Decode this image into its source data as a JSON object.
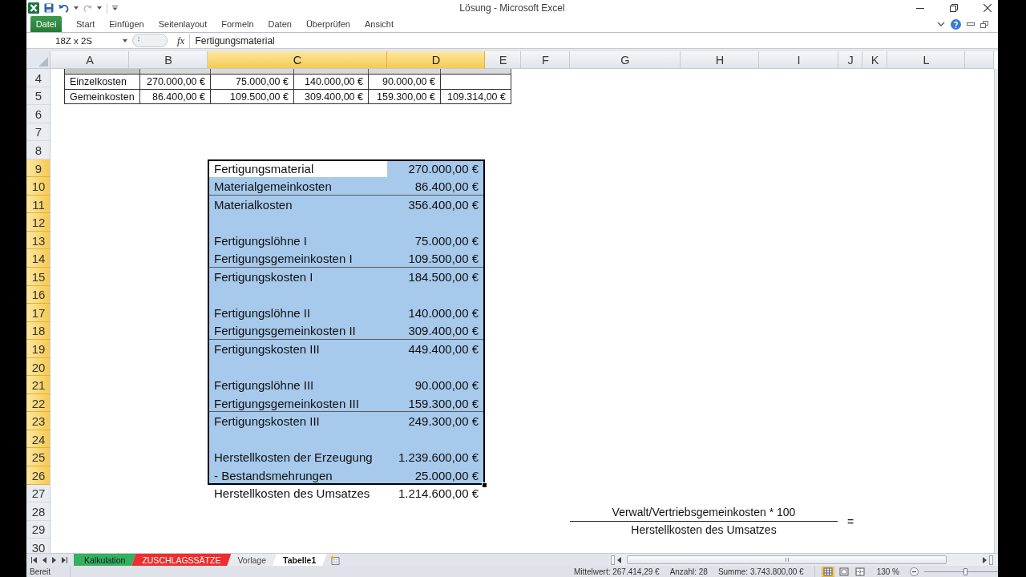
{
  "window": {
    "title": "Lösung - Microsoft Excel"
  },
  "ribbon_tabs": [
    {
      "label": "Datei",
      "kind": "file"
    },
    {
      "label": "Start",
      "kind": "tab"
    },
    {
      "label": "Einfügen",
      "kind": "tab"
    },
    {
      "label": "Seitenlayout",
      "kind": "tab"
    },
    {
      "label": "Formeln",
      "kind": "tab"
    },
    {
      "label": "Daten",
      "kind": "tab"
    },
    {
      "label": "Überprüfen",
      "kind": "tab"
    },
    {
      "label": "Ansicht",
      "kind": "tab"
    }
  ],
  "formula_bar": {
    "name_box": "18Z x 2S",
    "function_label": "fx",
    "content": "Fertigungsmaterial"
  },
  "columns": [
    {
      "label": "A",
      "selected": false
    },
    {
      "label": "B",
      "selected": false
    },
    {
      "label": "C",
      "selected": true
    },
    {
      "label": "D",
      "selected": true
    },
    {
      "label": "E",
      "selected": false
    },
    {
      "label": "F",
      "selected": false
    },
    {
      "label": "G",
      "selected": false
    },
    {
      "label": "H",
      "selected": false
    },
    {
      "label": "I",
      "selected": false
    },
    {
      "label": "J",
      "selected": false
    },
    {
      "label": "K",
      "selected": false
    },
    {
      "label": "L",
      "selected": false
    }
  ],
  "row_headers": [
    {
      "number": "4",
      "selected": false
    },
    {
      "number": "5",
      "selected": false
    },
    {
      "number": "6",
      "selected": false
    },
    {
      "number": "7",
      "selected": false
    },
    {
      "number": "8",
      "selected": false
    },
    {
      "number": "9",
      "selected": true
    },
    {
      "number": "10",
      "selected": true
    },
    {
      "number": "11",
      "selected": true
    },
    {
      "number": "12",
      "selected": true
    },
    {
      "number": "13",
      "selected": true
    },
    {
      "number": "14",
      "selected": true
    },
    {
      "number": "15",
      "selected": true
    },
    {
      "number": "16",
      "selected": true
    },
    {
      "number": "17",
      "selected": true
    },
    {
      "number": "18",
      "selected": true
    },
    {
      "number": "19",
      "selected": true
    },
    {
      "number": "20",
      "selected": true
    },
    {
      "number": "21",
      "selected": true
    },
    {
      "number": "22",
      "selected": true
    },
    {
      "number": "23",
      "selected": true
    },
    {
      "number": "24",
      "selected": true
    },
    {
      "number": "25",
      "selected": true
    },
    {
      "number": "26",
      "selected": true
    },
    {
      "number": "27",
      "selected": false
    },
    {
      "number": "28",
      "selected": false
    },
    {
      "number": "29",
      "selected": false
    },
    {
      "number": "30",
      "selected": false
    }
  ],
  "cost_table": {
    "rows": [
      {
        "label": "Einzelkosten",
        "values": [
          "270.000,00 €",
          "75.000,00 €",
          "140.000,00 €",
          "90.000,00 €"
        ]
      },
      {
        "label": "Gemeinkosten",
        "values": [
          "86.400,00 €",
          "109.500,00 €",
          "309.400,00 €",
          "159.300,00 €",
          "109.314,00 €"
        ]
      }
    ]
  },
  "calculation": [
    {
      "label": "Fertigungsmaterial",
      "value": "270.000,00 €",
      "selected": true,
      "active": true,
      "rule_below": false
    },
    {
      "label": "Materialgemeinkosten",
      "value": "86.400,00 €",
      "selected": true,
      "active": false,
      "rule_below": true
    },
    {
      "label": "Materialkosten",
      "value": "356.400,00 €",
      "selected": true,
      "active": false,
      "rule_below": false
    },
    {
      "selected": true,
      "active": false,
      "rule_below": false
    },
    {
      "label": "Fertigungslöhne I",
      "value": "75.000,00 €",
      "selected": true,
      "active": false,
      "rule_below": false
    },
    {
      "label": "Fertigungsgemeinkosten I",
      "value": "109.500,00 €",
      "selected": true,
      "active": false,
      "rule_below": true
    },
    {
      "label": "Fertigungskosten I",
      "value": "184.500,00 €",
      "selected": true,
      "active": false,
      "rule_below": false
    },
    {
      "selected": true,
      "active": false,
      "rule_below": false
    },
    {
      "label": "Fertigungslöhne II",
      "value": "140.000,00 €",
      "selected": true,
      "active": false,
      "rule_below": false
    },
    {
      "label": "Fertigungsgemeinkosten II",
      "value": "309.400,00 €",
      "selected": true,
      "active": false,
      "rule_below": true
    },
    {
      "label": "Fertigungskosten III",
      "value": "449.400,00 €",
      "selected": true,
      "active": false,
      "rule_below": false
    },
    {
      "selected": true,
      "active": false,
      "rule_below": false
    },
    {
      "label": "Fertigungslöhne III",
      "value": "90.000,00 €",
      "selected": true,
      "active": false,
      "rule_below": false
    },
    {
      "label": "Fertigungsgemeinkosten III",
      "value": "159.300,00 €",
      "selected": true,
      "active": false,
      "rule_below": true
    },
    {
      "label": "Fertigungskosten III",
      "value": "249.300,00 €",
      "selected": true,
      "active": false,
      "rule_below": false
    },
    {
      "selected": true,
      "active": false,
      "rule_below": false
    },
    {
      "label": "Herstellkosten der Erzeugung",
      "value": "1.239.600,00 €",
      "selected": true,
      "active": false,
      "rule_below": false
    },
    {
      "label": "- Bestandsmehrungen",
      "value": "25.000,00 €",
      "selected": true,
      "active": false,
      "rule_below": false
    },
    {
      "label": "Herstellkosten des Umsatzes",
      "value": "1.214.600,00 €",
      "selected": false,
      "active": false,
      "rule_below": false
    }
  ],
  "ratio_formula": {
    "numerator": "Verwalt/Vertriebsgemeinkosten * 100",
    "denominator": "Herstellkosten des Umsatzes",
    "equals": "="
  },
  "sheet_tabs": [
    {
      "label": "Kalkulation",
      "color": "#33b060",
      "selected": false
    },
    {
      "label": "ZUSCHLAGSSÄTZE",
      "color": "#ee2e2e",
      "selected": false
    },
    {
      "label": "Vorlage",
      "selected": false
    },
    {
      "label": "Tabelle1",
      "selected": true
    }
  ],
  "status_bar": {
    "mode": "Bereit",
    "average": "Mittelwert: 267.414,29 €",
    "count": "Anzahl: 28",
    "sum": "Summe: 3.743.800,00 €",
    "views": [
      {
        "kind": "normal",
        "selected": true
      },
      {
        "kind": "page_layout",
        "selected": false
      },
      {
        "kind": "page_break",
        "selected": false
      }
    ],
    "zoom": "130 %",
    "zoom_slider": {
      "level": 0.55
    }
  }
}
